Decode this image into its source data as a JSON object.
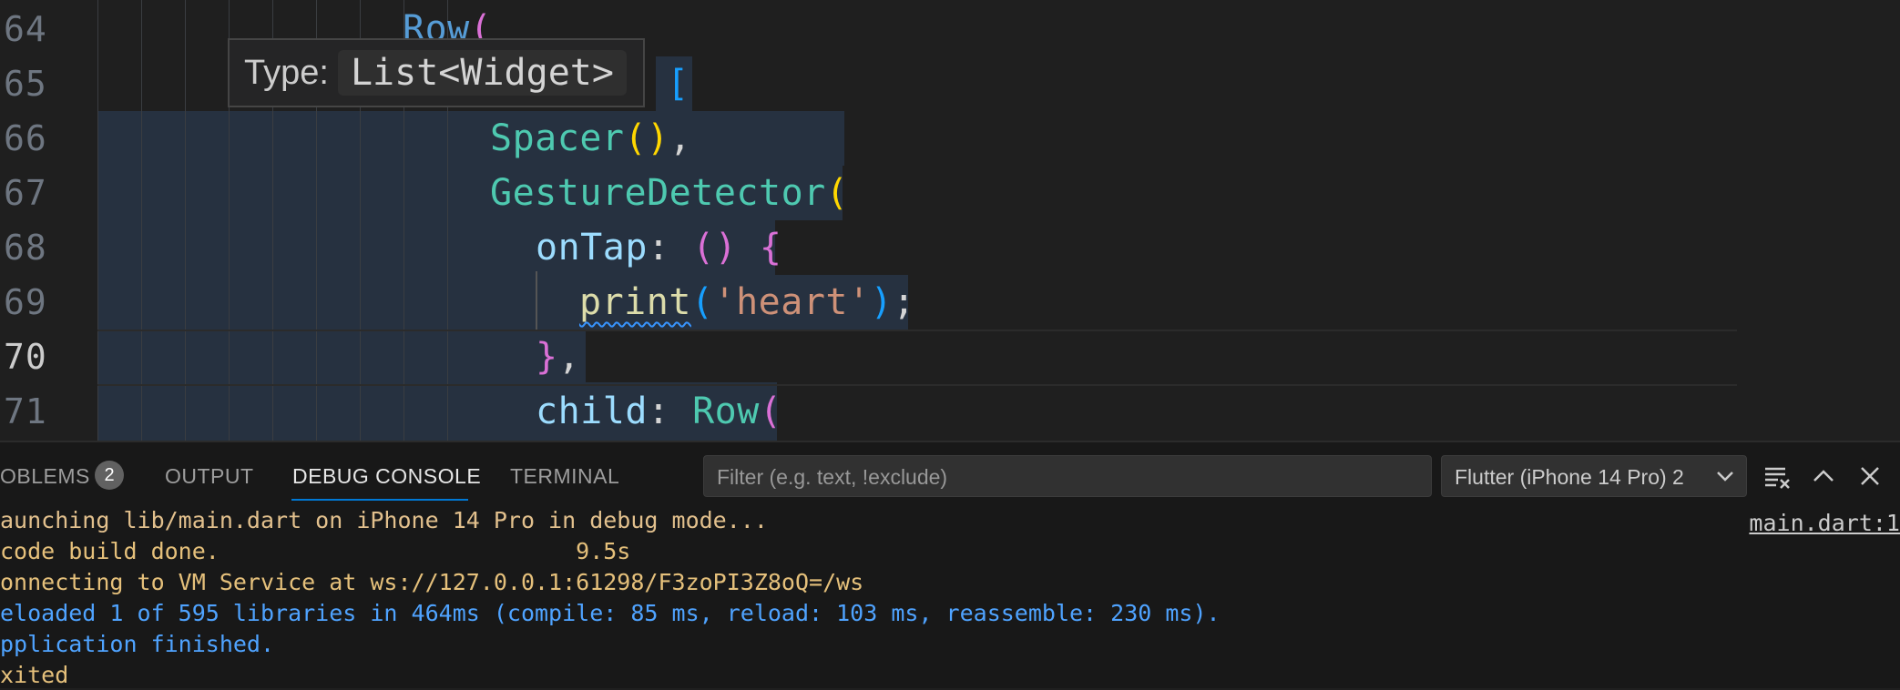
{
  "editor": {
    "lines": [
      {
        "num": "64"
      },
      {
        "num": "65"
      },
      {
        "num": "66"
      },
      {
        "num": "67"
      },
      {
        "num": "68"
      },
      {
        "num": "69"
      },
      {
        "num": "70"
      },
      {
        "num": "71"
      }
    ],
    "tokens": {
      "row": "Row",
      "open_paren": "(",
      "open_bracket": "[",
      "spacer": "Spacer",
      "parens": "()",
      "comma": ",",
      "gesture": "GestureDetector",
      "ontap": "onTap",
      "colon": ": ",
      "open_brace": "{",
      "print": "print",
      "paren_l": "(",
      "str": "'heart'",
      "paren_r": ")",
      "semi": ";",
      "close_brace": "}",
      "child": "child",
      "row2": "Row"
    },
    "tooltip": {
      "label": "Type:",
      "type": "List<Widget>"
    }
  },
  "panel": {
    "tabs": [
      {
        "label": "OBLEMS"
      },
      {
        "label": "OUTPUT"
      },
      {
        "label": "DEBUG CONSOLE"
      },
      {
        "label": "TERMINAL"
      }
    ],
    "problems_count": "2",
    "filter_placeholder": "Filter (e.g. text, !exclude)",
    "session": "Flutter (iPhone 14 Pro) 2",
    "source_link": "main.dart:1",
    "console": [
      {
        "text": "aunching lib/main.dart on iPhone 14 Pro in debug mode...",
        "color": "#e2c08d"
      },
      {
        "text": "code build done.                          9.5s",
        "color": "#e5c07b"
      },
      {
        "text": "onnecting to VM Service at ws://127.0.0.1:61298/F3zoPI3Z8oQ=/ws",
        "color": "#e5c07b"
      },
      {
        "text": "eloaded 1 of 595 libraries in 464ms (compile: 85 ms, reload: 103 ms, reassemble: 230 ms).",
        "color": "#4fa3ff"
      },
      {
        "text": "pplication finished.",
        "color": "#4fa3ff"
      },
      {
        "text": "xited",
        "color": "#e5c07b"
      }
    ]
  },
  "icons": {
    "clear": "clear-console-icon",
    "maximize": "chevron-up-icon",
    "close": "close-icon",
    "dropdown": "chevron-down-icon"
  },
  "colors": {
    "accent": "#0078d4",
    "editor_bg": "#1f1f1f",
    "panel_bg": "#181818",
    "selection": "#263140"
  }
}
